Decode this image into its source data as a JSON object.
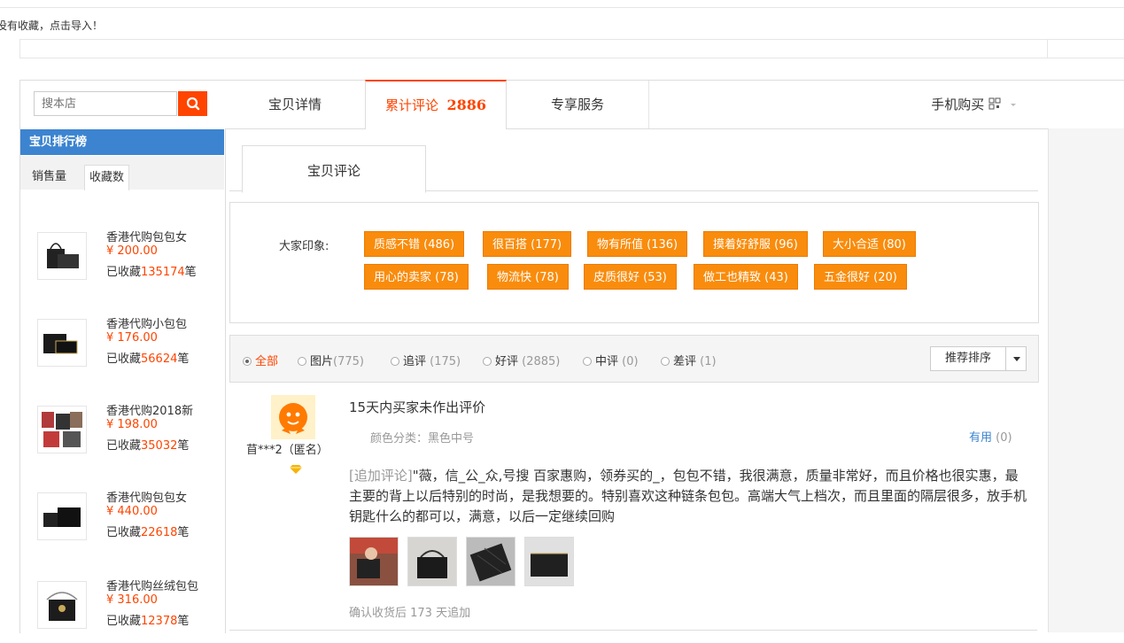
{
  "notice": "没有收藏，点击导入！",
  "search": {
    "placeholder": "搜本店"
  },
  "ranking": {
    "title": "宝贝排行榜",
    "tabs": [
      "销售量",
      "收藏数"
    ],
    "fav_prefix": "已收藏",
    "fav_suffix": "笔",
    "items": [
      {
        "name": "香港代购包包女",
        "price": "¥ 200.00",
        "fav": "135174"
      },
      {
        "name": "香港代购小包包",
        "price": "¥ 176.00",
        "fav": "56624"
      },
      {
        "name": "香港代购2018新",
        "price": "¥ 198.00",
        "fav": "35032"
      },
      {
        "name": "香港代购包包女",
        "price": "¥ 440.00",
        "fav": "22618"
      },
      {
        "name": "香港代购丝绒包包",
        "price": "¥ 316.00",
        "fav": "12378"
      }
    ]
  },
  "tabs": {
    "details": "宝贝详情",
    "reviews_label": "累计评论",
    "reviews_count": "2886",
    "service": "专享服务",
    "mobile": "手机购买"
  },
  "subtab": "宝贝评论",
  "impressions": {
    "label": "大家印象:",
    "tags": [
      "质感不错 (486)",
      "很百搭 (177)",
      "物有所值 (136)",
      "摸着好舒服 (96)",
      "大小合适 (80)",
      "用心的卖家 (78)",
      "物流快 (78)",
      "皮质很好 (53)",
      "做工也精致 (43)",
      "五金很好 (20)"
    ]
  },
  "filters": {
    "all": "全部",
    "pics": "图片",
    "pics_count": "(775)",
    "append": "追评",
    "append_count": "(175)",
    "good": "好评",
    "good_count": "(2885)",
    "mid": "中评",
    "mid_count": "(0)",
    "bad": "差评",
    "bad_count": "(1)",
    "sort": "推荐排序"
  },
  "review": {
    "username": "苜***2（匿名）",
    "title": "15天内买家未作出评价",
    "sku": "颜色分类：黑色中号",
    "useful_label": "有用",
    "useful_count": "(0)",
    "append_tag": "[追加评论]",
    "text": "\"薇，信_公_众,号搜 百家惠购，领券买的_，包包不错，我很满意，质量非常好，而且价格也很实惠，最主要的背上以后特别的时尚，是我想要的。特别喜欢这种链条包包。高端大气上档次，而且里面的隔层很多，放手机钥匙什么的都可以，满意，以后一定继续回购",
    "footer": "确认收货后 173 天追加"
  },
  "colors": {
    "accent": "#ff4400",
    "tag_bg": "#f98c0c",
    "rank_header": "#3c84d0"
  }
}
